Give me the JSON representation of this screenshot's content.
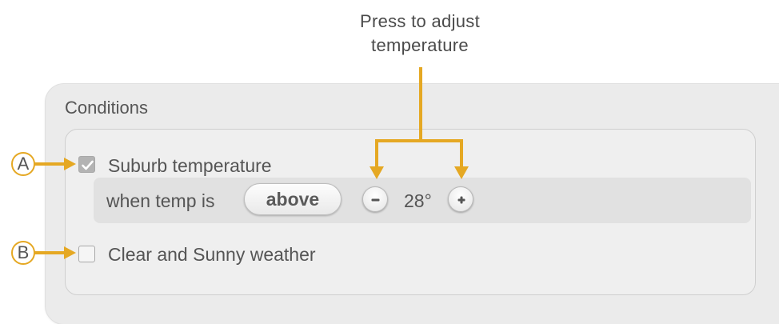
{
  "callout": {
    "line1": "Press to adjust",
    "line2": "temperature"
  },
  "conditions": {
    "title": "Conditions",
    "items": [
      {
        "label": "Suburb temperature",
        "checked": true
      },
      {
        "label": "Clear and Sunny weather",
        "checked": false
      }
    ],
    "temperature_rule": {
      "prefix": "when temp is",
      "mode": "above",
      "value": "28°",
      "decrease_symbol": "−",
      "increase_symbol": "+"
    }
  },
  "markers": {
    "a": "A",
    "b": "B"
  },
  "colors": {
    "accent": "#e5a823",
    "panel": "#ebebeb",
    "card": "#efefef",
    "subrow": "#e1e1e1",
    "text": "#555555"
  },
  "icons": {
    "check": "check-icon",
    "minus": "minus-icon",
    "plus": "plus-icon"
  }
}
